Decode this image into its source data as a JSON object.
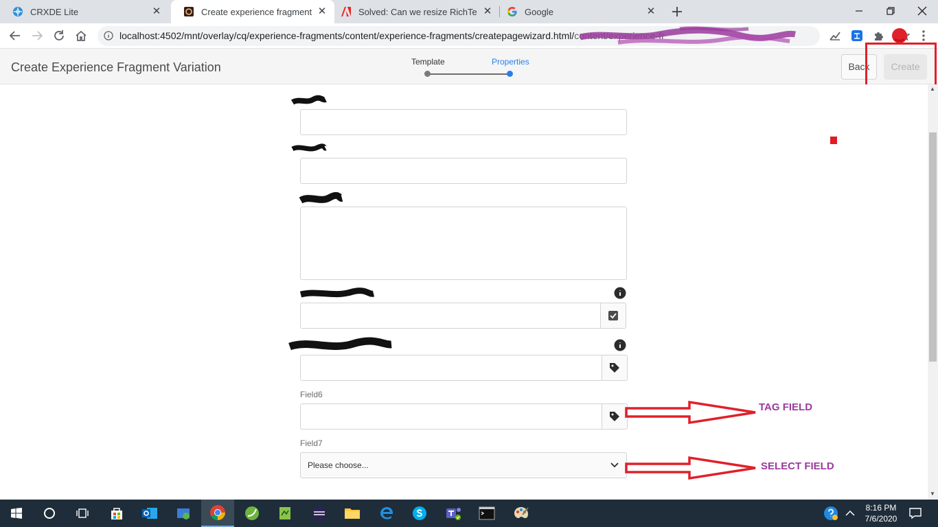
{
  "browser": {
    "tabs": [
      {
        "title": "CRXDE Lite",
        "icon": "crxde-icon",
        "active": false
      },
      {
        "title": "Create experience fragment",
        "icon": "aem-icon",
        "active": true
      },
      {
        "title": "Solved: Can we resize RichTextEd",
        "icon": "adobe-icon",
        "active": false
      },
      {
        "title": "Google",
        "icon": "google-icon",
        "active": false
      }
    ],
    "url": "localhost:4502/mnt/overlay/cq/experience-fragments/content/experience-fragments/createpagewizard.html/",
    "url_tail": "content/experience-fr"
  },
  "wizard": {
    "title": "Create Experience Fragment Variation",
    "steps": [
      {
        "label": "Template",
        "active": false
      },
      {
        "label": "Properties",
        "active": true
      }
    ],
    "back_label": "Back",
    "create_label": "Create"
  },
  "form": {
    "field6_label": "Field6",
    "field7_label": "Field7",
    "field7_value": "Please choose..."
  },
  "annotations": {
    "tag_field": "TAG FIELD",
    "select_field": "SELECT FIELD",
    "color": "#9b3a9c",
    "arrow_color": "#e0202a"
  },
  "taskbar": {
    "time": "8:16 PM",
    "date": "7/6/2020"
  }
}
